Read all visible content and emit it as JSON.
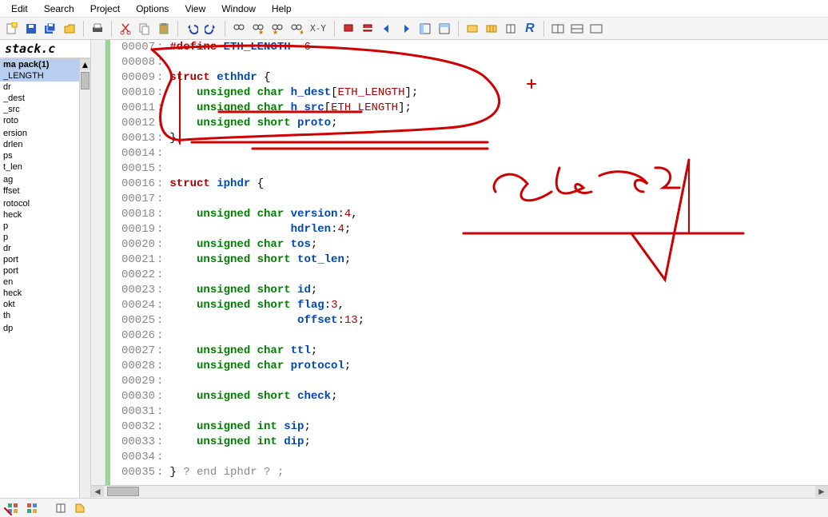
{
  "menu": {
    "items": [
      "Edit",
      "Search",
      "Project",
      "Options",
      "View",
      "Window",
      "Help"
    ]
  },
  "toolbar": {
    "newfile": "new-file",
    "save": "save",
    "saveall": "save-all",
    "openfolder": "open-folder",
    "print": "print",
    "cut": "cut",
    "copy": "copy",
    "paste": "paste",
    "undo": "undo",
    "redo": "redo",
    "find1": "find-binoc",
    "find2": "find-binoc-star",
    "find3": "find-binoc-star2",
    "find4": "find-binoc-star3",
    "xy_label": "X-Y",
    "bookmark_set": "bm-set",
    "bookmark_del": "bm-del",
    "nav_back": "back",
    "nav_fwd": "forward",
    "layout1": "layout1",
    "layout2": "layout2",
    "macro1": "macro1",
    "macro2": "macro2",
    "book": "book",
    "ritalic": "R",
    "win1": "win1",
    "win2": "win2",
    "win3": "win3"
  },
  "sidebar": {
    "tab": "stack.c",
    "items": [
      {
        "label": "ma pack(1)",
        "cls": "hdr"
      },
      {
        "label": "_LENGTH",
        "cls": "alt"
      },
      {
        "label": "dr",
        "cls": ""
      },
      {
        "label": "_dest",
        "cls": ""
      },
      {
        "label": "_src",
        "cls": ""
      },
      {
        "label": "roto",
        "cls": ""
      },
      {
        "label": "",
        "cls": ""
      },
      {
        "label": "ersion",
        "cls": ""
      },
      {
        "label": "drlen",
        "cls": ""
      },
      {
        "label": "ps",
        "cls": ""
      },
      {
        "label": "t_len",
        "cls": ""
      },
      {
        "label": "",
        "cls": ""
      },
      {
        "label": "ag",
        "cls": ""
      },
      {
        "label": "ffset",
        "cls": ""
      },
      {
        "label": "",
        "cls": ""
      },
      {
        "label": "rotocol",
        "cls": ""
      },
      {
        "label": "heck",
        "cls": ""
      },
      {
        "label": "p",
        "cls": ""
      },
      {
        "label": "p",
        "cls": ""
      },
      {
        "label": "dr",
        "cls": ""
      },
      {
        "label": "port",
        "cls": ""
      },
      {
        "label": "port",
        "cls": ""
      },
      {
        "label": "en",
        "cls": ""
      },
      {
        "label": "heck",
        "cls": ""
      },
      {
        "label": "okt",
        "cls": ""
      },
      {
        "label": "th",
        "cls": ""
      },
      {
        "label": "",
        "cls": ""
      },
      {
        "label": "dp",
        "cls": ""
      }
    ],
    "scroll_top_arrow": "▲"
  },
  "code": {
    "lines": [
      {
        "n": "00007",
        "tokens": [
          {
            "t": "#define",
            "c": "kw"
          },
          {
            "t": " ",
            "c": ""
          },
          {
            "t": "ETH_LENGTH",
            "c": "name"
          },
          {
            "t": "  ",
            "c": ""
          },
          {
            "t": "6",
            "c": "num"
          }
        ]
      },
      {
        "n": "00008",
        "tokens": []
      },
      {
        "n": "00009",
        "tokens": [
          {
            "t": "struct",
            "c": "kw"
          },
          {
            "t": " ",
            "c": ""
          },
          {
            "t": "ethhdr",
            "c": "name"
          },
          {
            "t": " {",
            "c": "punct"
          }
        ]
      },
      {
        "n": "00010",
        "tokens": [
          {
            "t": "    ",
            "c": ""
          },
          {
            "t": "unsigned char",
            "c": "type"
          },
          {
            "t": " ",
            "c": ""
          },
          {
            "t": "h_dest",
            "c": "field"
          },
          {
            "t": "[",
            "c": "punct"
          },
          {
            "t": "ETH_LENGTH",
            "c": "const"
          },
          {
            "t": "];",
            "c": "punct"
          }
        ]
      },
      {
        "n": "00011",
        "tokens": [
          {
            "t": "    ",
            "c": ""
          },
          {
            "t": "unsigned char",
            "c": "type"
          },
          {
            "t": " ",
            "c": ""
          },
          {
            "t": "h_src",
            "c": "field"
          },
          {
            "t": "[",
            "c": "punct"
          },
          {
            "t": "ETH_LENGTH",
            "c": "const"
          },
          {
            "t": "];",
            "c": "punct"
          }
        ]
      },
      {
        "n": "00012",
        "tokens": [
          {
            "t": "    ",
            "c": ""
          },
          {
            "t": "unsigned short",
            "c": "type"
          },
          {
            "t": " ",
            "c": ""
          },
          {
            "t": "proto",
            "c": "field"
          },
          {
            "t": ";",
            "c": "punct"
          }
        ]
      },
      {
        "n": "00013",
        "tokens": [
          {
            "t": "};",
            "c": "punct"
          }
        ]
      },
      {
        "n": "00014",
        "tokens": []
      },
      {
        "n": "00015",
        "tokens": []
      },
      {
        "n": "00016",
        "tokens": [
          {
            "t": "struct",
            "c": "kw"
          },
          {
            "t": " ",
            "c": ""
          },
          {
            "t": "iphdr",
            "c": "name"
          },
          {
            "t": " {",
            "c": "punct"
          }
        ]
      },
      {
        "n": "00017",
        "tokens": []
      },
      {
        "n": "00018",
        "tokens": [
          {
            "t": "    ",
            "c": ""
          },
          {
            "t": "unsigned char",
            "c": "type"
          },
          {
            "t": " ",
            "c": ""
          },
          {
            "t": "version",
            "c": "field"
          },
          {
            "t": ":",
            "c": "punct"
          },
          {
            "t": "4",
            "c": "num"
          },
          {
            "t": ",",
            "c": "punct"
          }
        ]
      },
      {
        "n": "00019",
        "tokens": [
          {
            "t": "                  ",
            "c": ""
          },
          {
            "t": "hdrlen",
            "c": "field"
          },
          {
            "t": ":",
            "c": "punct"
          },
          {
            "t": "4",
            "c": "num"
          },
          {
            "t": ";",
            "c": "punct"
          }
        ]
      },
      {
        "n": "00020",
        "tokens": [
          {
            "t": "    ",
            "c": ""
          },
          {
            "t": "unsigned char",
            "c": "type"
          },
          {
            "t": " ",
            "c": ""
          },
          {
            "t": "tos",
            "c": "field"
          },
          {
            "t": ";",
            "c": "punct"
          }
        ]
      },
      {
        "n": "00021",
        "tokens": [
          {
            "t": "    ",
            "c": ""
          },
          {
            "t": "unsigned short",
            "c": "type"
          },
          {
            "t": " ",
            "c": ""
          },
          {
            "t": "tot_len",
            "c": "field"
          },
          {
            "t": ";",
            "c": "punct"
          }
        ]
      },
      {
        "n": "00022",
        "tokens": []
      },
      {
        "n": "00023",
        "tokens": [
          {
            "t": "    ",
            "c": ""
          },
          {
            "t": "unsigned short",
            "c": "type"
          },
          {
            "t": " ",
            "c": ""
          },
          {
            "t": "id",
            "c": "field"
          },
          {
            "t": ";",
            "c": "punct"
          }
        ]
      },
      {
        "n": "00024",
        "tokens": [
          {
            "t": "    ",
            "c": ""
          },
          {
            "t": "unsigned short",
            "c": "type"
          },
          {
            "t": " ",
            "c": ""
          },
          {
            "t": "flag",
            "c": "field"
          },
          {
            "t": ":",
            "c": "punct"
          },
          {
            "t": "3",
            "c": "num"
          },
          {
            "t": ",",
            "c": "punct"
          }
        ]
      },
      {
        "n": "00025",
        "tokens": [
          {
            "t": "                   ",
            "c": ""
          },
          {
            "t": "offset",
            "c": "field"
          },
          {
            "t": ":",
            "c": "punct"
          },
          {
            "t": "13",
            "c": "num"
          },
          {
            "t": ";",
            "c": "punct"
          }
        ]
      },
      {
        "n": "00026",
        "tokens": []
      },
      {
        "n": "00027",
        "tokens": [
          {
            "t": "    ",
            "c": ""
          },
          {
            "t": "unsigned char",
            "c": "type"
          },
          {
            "t": " ",
            "c": ""
          },
          {
            "t": "ttl",
            "c": "field"
          },
          {
            "t": ";",
            "c": "punct"
          }
        ]
      },
      {
        "n": "00028",
        "tokens": [
          {
            "t": "    ",
            "c": ""
          },
          {
            "t": "unsigned char",
            "c": "type"
          },
          {
            "t": " ",
            "c": ""
          },
          {
            "t": "protocol",
            "c": "field"
          },
          {
            "t": ";",
            "c": "punct"
          }
        ]
      },
      {
        "n": "00029",
        "tokens": []
      },
      {
        "n": "00030",
        "tokens": [
          {
            "t": "    ",
            "c": ""
          },
          {
            "t": "unsigned short",
            "c": "type"
          },
          {
            "t": " ",
            "c": ""
          },
          {
            "t": "check",
            "c": "field"
          },
          {
            "t": ";",
            "c": "punct"
          }
        ]
      },
      {
        "n": "00031",
        "tokens": []
      },
      {
        "n": "00032",
        "tokens": [
          {
            "t": "    ",
            "c": ""
          },
          {
            "t": "unsigned int",
            "c": "type"
          },
          {
            "t": " ",
            "c": ""
          },
          {
            "t": "sip",
            "c": "field"
          },
          {
            "t": ";",
            "c": "punct"
          }
        ]
      },
      {
        "n": "00033",
        "tokens": [
          {
            "t": "    ",
            "c": ""
          },
          {
            "t": "unsigned int",
            "c": "type"
          },
          {
            "t": " ",
            "c": ""
          },
          {
            "t": "dip",
            "c": "field"
          },
          {
            "t": ";",
            "c": "punct"
          }
        ]
      },
      {
        "n": "00034",
        "tokens": []
      },
      {
        "n": "00035",
        "tokens": [
          {
            "t": "} ",
            "c": "punct"
          },
          {
            "t": "? end iphdr ? ;",
            "c": "cmt"
          }
        ]
      }
    ]
  },
  "annotation": {
    "color": "#cc0000",
    "note": "SRe…"
  }
}
